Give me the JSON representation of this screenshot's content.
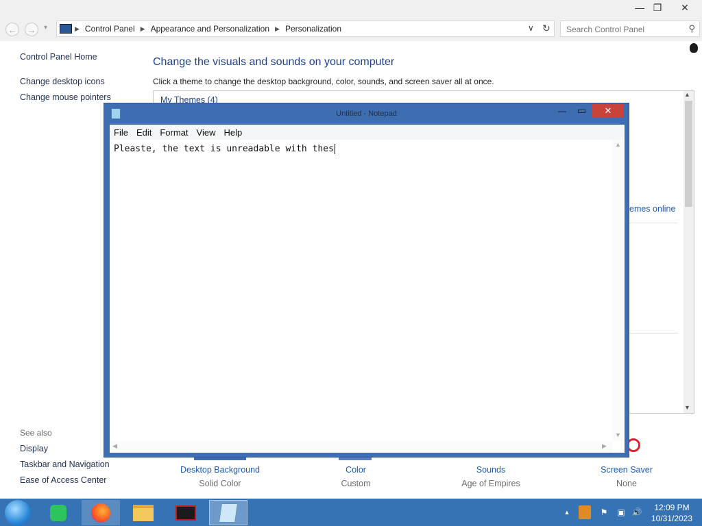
{
  "control_panel": {
    "window_controls": {
      "minimize": "—",
      "restore": "❐",
      "close": "✕"
    },
    "nav": {
      "back": "←",
      "forward": "→",
      "recent": "▾",
      "dropdown": "∨",
      "refresh": "↻"
    },
    "breadcrumb": [
      "Control Panel",
      "Appearance and Personalization",
      "Personalization"
    ],
    "search_placeholder": "Search Control Panel",
    "sidebar": {
      "home": "Control Panel Home",
      "links": [
        "Change desktop icons",
        "Change mouse pointers"
      ],
      "see_also_title": "See also",
      "see_also": [
        "Display",
        "Taskbar and Navigation",
        "Ease of Access Center"
      ]
    },
    "heading": "Change the visuals and sounds on your computer",
    "subheading": "Click a theme to change the desktop background, color, sounds, and screen saver all at once.",
    "my_themes": "My Themes (4)",
    "themes_online": "emes online",
    "options": [
      {
        "label": "Desktop Background",
        "value": "Solid Color"
      },
      {
        "label": "Color",
        "value": "Custom"
      },
      {
        "label": "Sounds",
        "value": "Age of Empires"
      },
      {
        "label": "Screen Saver",
        "value": "None"
      }
    ]
  },
  "notepad": {
    "title": "Untitled - Notepad",
    "menu": [
      "File",
      "Edit",
      "Format",
      "View",
      "Help"
    ],
    "text": "Pleaste, the text is unreadable with thes",
    "controls": {
      "minimize": "—",
      "maximize": "▭",
      "close": "✕"
    }
  },
  "taskbar": {
    "clock_time": "12:09 PM",
    "clock_date": "10/31/2023",
    "tray_chevron": "▲"
  },
  "colors": {
    "taskbar": "#3673b5",
    "notepad_frame": "#3f6db2",
    "close_button": "#c9433a",
    "link": "#1e5bb8"
  }
}
